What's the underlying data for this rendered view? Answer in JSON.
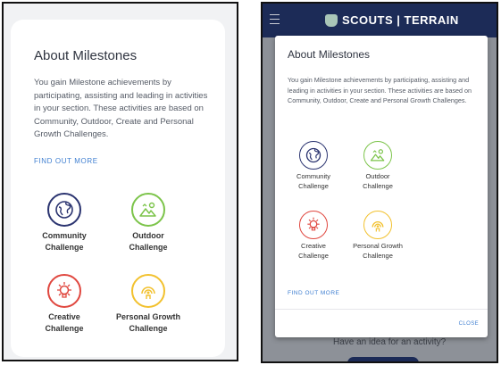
{
  "left": {
    "title": "About Milestones",
    "body": "You gain Milestone achievements by participating, assisting and leading in activities in your section. These activities are based on Community, Outdoor, Create and Personal Growth Challenges.",
    "find_out_more": "FIND OUT MORE",
    "challenges": [
      {
        "line1": "Community",
        "line2": "Challenge",
        "icon": "globe-icon",
        "color": "#2b3470"
      },
      {
        "line1": "Outdoor",
        "line2": "Challenge",
        "icon": "mountain-sun-icon",
        "color": "#7cc44a"
      },
      {
        "line1": "Creative",
        "line2": "Challenge",
        "icon": "lightbulb-icon",
        "color": "#e0473f"
      },
      {
        "line1": "Personal Growth",
        "line2": "Challenge",
        "icon": "signal-person-icon",
        "color": "#f2c12e"
      }
    ]
  },
  "right": {
    "brand_text": "SCOUTS | TERRAIN",
    "background_text": "Have an idea for an activity?",
    "modal": {
      "title": "About Milestones",
      "body": "You gain Milestone achievements by participating, assisting and leading in activities in your section. These activities are based on Community, Outdoor, Create and Personal Growth Challenges.",
      "find_out_more": "FIND OUT MORE",
      "close": "CLOSE"
    },
    "challenges": [
      {
        "line1": "Community",
        "line2": "Challenge",
        "icon": "globe-icon",
        "color": "#2b3470"
      },
      {
        "line1": "Outdoor",
        "line2": "Challenge",
        "icon": "mountain-sun-icon",
        "color": "#7cc44a"
      },
      {
        "line1": "Creative",
        "line2": "Challenge",
        "icon": "lightbulb-icon",
        "color": "#e0473f"
      },
      {
        "line1": "Personal Growth",
        "line2": "Challenge",
        "icon": "signal-person-icon",
        "color": "#f2c12e"
      }
    ]
  }
}
